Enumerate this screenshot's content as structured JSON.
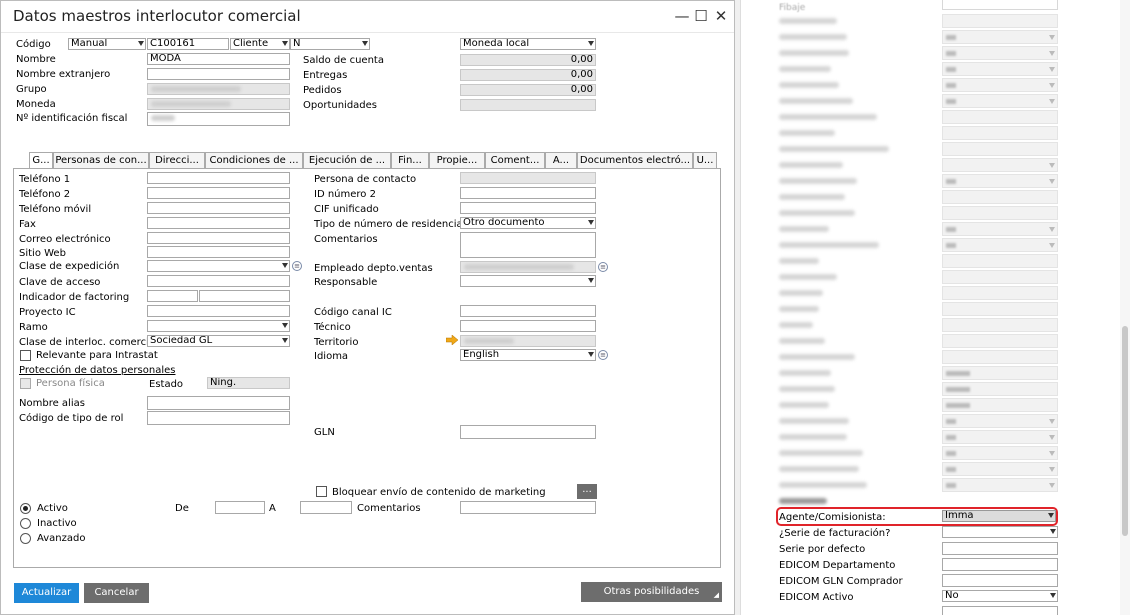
{
  "window": {
    "title": "Datos maestros interlocutor comercial",
    "minimize": "—",
    "maximize": "☐",
    "close": "✕"
  },
  "header": {
    "codigo_label": "Código",
    "serie": "Manual",
    "codigo": "C100161",
    "tipo": "Cliente",
    "tipo2": "N",
    "nombre_label": "Nombre",
    "nombre": "MODA",
    "nombre_ext_label": "Nombre extranjero",
    "grupo_label": "Grupo",
    "moneda_label": "Moneda",
    "nif_label": "Nº identificación fiscal",
    "moneda_local": "Moneda local",
    "saldo_label": "Saldo de cuenta",
    "saldo": "0,00",
    "entregas_label": "Entregas",
    "entregas": "0,00",
    "pedidos_label": "Pedidos",
    "pedidos": "0,00",
    "oportunidades_label": "Oportunidades"
  },
  "tabs": [
    "G...",
    "Personas de con...",
    "Direcci...",
    "Condiciones de ...",
    "Ejecución de ...",
    "Fin...",
    "Propie...",
    "Coment...",
    "A...",
    "Documentos electró...",
    "U..."
  ],
  "general": {
    "telefono1": "Teléfono 1",
    "telefono2": "Teléfono 2",
    "movil": "Teléfono móvil",
    "fax": "Fax",
    "correo": "Correo electrónico",
    "web": "Sitio Web",
    "expedicion": "Clase de expedición",
    "clave": "Clave de acceso",
    "factoring": "Indicador de factoring",
    "proyecto": "Proyecto IC",
    "ramo": "Ramo",
    "clase_interloc": "Clase de interloc. comercial",
    "clase_interloc_val": "Sociedad GL",
    "intrastat": "Relevante para Intrastat",
    "proteccion": "Protección de datos personales",
    "persona_fisica": "Persona física",
    "estado": "Estado",
    "estado_val": "Ning.",
    "alias": "Nombre alias",
    "rol": "Código de tipo de rol",
    "persona_contacto": "Persona de contacto",
    "id2": "ID número 2",
    "cif": "CIF unificado",
    "tipo_residencia": "Tipo de número de residencia",
    "tipo_residencia_val": "Otro documento",
    "comentarios": "Comentarios",
    "empleado": "Empleado depto.ventas",
    "responsable": "Responsable",
    "codigo_canal": "Código canal IC",
    "tecnico": "Técnico",
    "territorio": "Territorio",
    "idioma": "Idioma",
    "idioma_val": "English",
    "gln": "GLN",
    "bloquear": "Bloquear envío de contenido de marketing",
    "more": "...",
    "activo": "Activo",
    "inactivo": "Inactivo",
    "avanzado": "Avanzado",
    "de": "De",
    "a": "A",
    "comentarios2": "Comentarios"
  },
  "footer": {
    "actualizar": "Actualizar",
    "cancelar": "Cancelar",
    "otras": "Otras posibilidades"
  },
  "right_panel": {
    "top_label": "Fibaje",
    "agente_label": "Agente/Comisionista:",
    "agente_val": "Imma",
    "serie_fact": "¿Serie de facturación?",
    "serie_defecto": "Serie por defecto",
    "edicom_dep": "EDICOM Departamento",
    "edicom_gln": "EDICOM GLN Comprador",
    "edicom_activo": "EDICOM Activo",
    "edicom_activo_val": "No"
  },
  "colors": {
    "accent": "#1e88d8",
    "cancel": "#6d6d6d",
    "highlight": "#e0242a",
    "arrow": "#f0a818"
  }
}
